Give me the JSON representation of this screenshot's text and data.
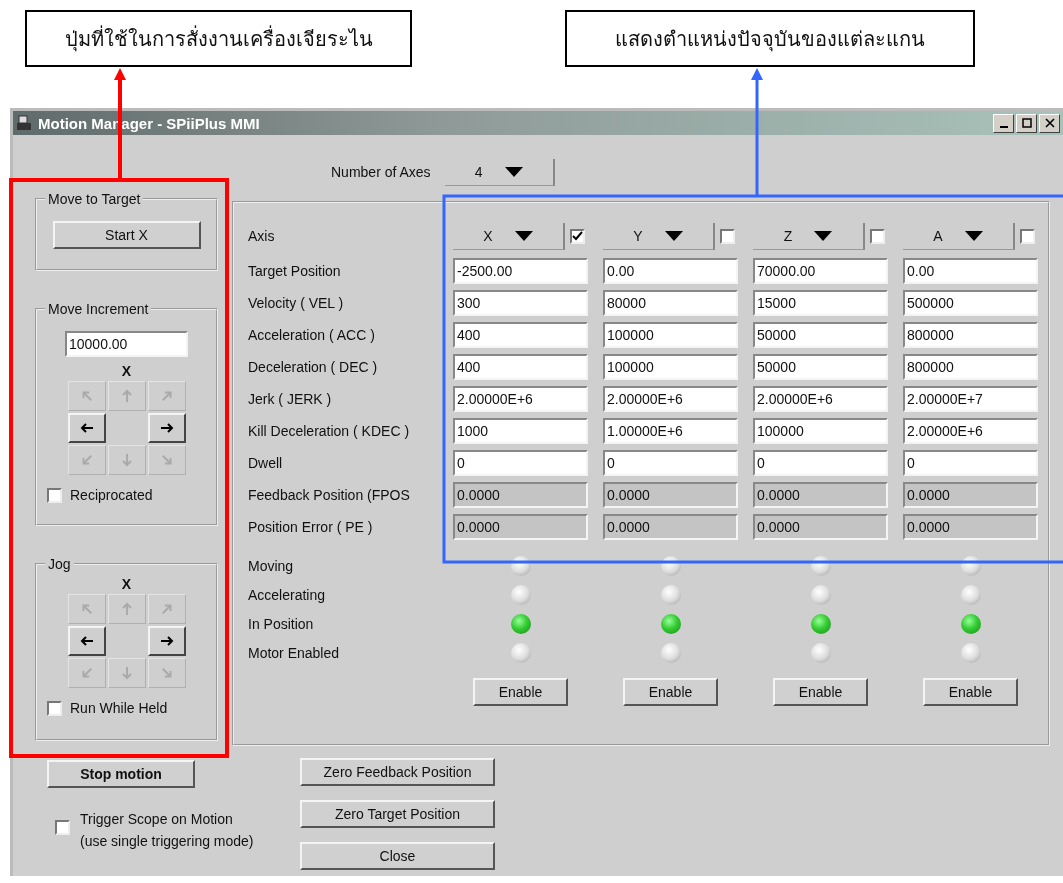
{
  "annotations": [
    {
      "text": "ปุ่มที่ใช้ในการสั่งงานเครื่องเจียระไน",
      "color": "#ff0000"
    },
    {
      "text": "แสดงตำแหน่งปัจจุบันของแต่ละแกน",
      "color": "#3366ff"
    }
  ],
  "window": {
    "title": "Motion Manager - SPiiPlus MMI"
  },
  "number_of_axes": {
    "label": "Number of Axes",
    "value": "4"
  },
  "move_to_target": {
    "title": "Move to Target",
    "button": "Start X"
  },
  "move_increment": {
    "title": "Move Increment",
    "value": "10000.00",
    "axis": "X",
    "pad": [
      {
        "kind": "nw",
        "disabled": true
      },
      {
        "kind": "n",
        "disabled": true
      },
      {
        "kind": "ne",
        "disabled": true
      },
      {
        "kind": "w",
        "disabled": false
      },
      {
        "kind": "e",
        "disabled": false
      },
      {
        "kind": "sw",
        "disabled": true
      },
      {
        "kind": "s",
        "disabled": true
      },
      {
        "kind": "se",
        "disabled": true
      }
    ],
    "reciprocated": {
      "label": "Reciprocated",
      "checked": false
    }
  },
  "jog": {
    "title": "Jog",
    "axis": "X",
    "pad": [
      {
        "kind": "nw",
        "disabled": true
      },
      {
        "kind": "n",
        "disabled": true
      },
      {
        "kind": "ne",
        "disabled": true
      },
      {
        "kind": "w",
        "disabled": false
      },
      {
        "kind": "e",
        "disabled": false
      },
      {
        "kind": "sw",
        "disabled": true
      },
      {
        "kind": "s",
        "disabled": true
      },
      {
        "kind": "se",
        "disabled": true
      }
    ],
    "run_while_held": {
      "label": "Run While Held",
      "checked": false
    }
  },
  "axes_panel": {
    "axis_label": "Axis",
    "rows": [
      {
        "label": "Target Position",
        "kind": "input"
      },
      {
        "label": "Velocity ( VEL )",
        "kind": "input"
      },
      {
        "label": "Acceleration ( ACC )",
        "kind": "input"
      },
      {
        "label": "Deceleration ( DEC )",
        "kind": "input"
      },
      {
        "label": "Jerk ( JERK )",
        "kind": "input"
      },
      {
        "label": "Kill Deceleration ( KDEC )",
        "kind": "input"
      },
      {
        "label": "Dwell",
        "kind": "input"
      },
      {
        "label": "Feedback Position (FPOS",
        "kind": "readout"
      },
      {
        "label": "Position Error ( PE )",
        "kind": "readout"
      }
    ],
    "indicators": [
      "Moving",
      "Accelerating",
      "In Position",
      "Motor Enabled"
    ],
    "axes": [
      {
        "name": "X",
        "checked": true,
        "values": [
          "-2500.00",
          "300",
          "400",
          "400",
          "2.00000E+6",
          "1000",
          "0",
          "0.0000",
          "0.0000"
        ],
        "leds": [
          {
            "on": false
          },
          {
            "on": false
          },
          {
            "on": true
          },
          {
            "on": false
          }
        ],
        "button": "Enable"
      },
      {
        "name": "Y",
        "checked": false,
        "values": [
          "0.00",
          "80000",
          "100000",
          "100000",
          "2.00000E+6",
          "1.00000E+6",
          "0",
          "0.0000",
          "0.0000"
        ],
        "leds": [
          {
            "on": false
          },
          {
            "on": false
          },
          {
            "on": true
          },
          {
            "on": false
          }
        ],
        "button": "Enable"
      },
      {
        "name": "Z",
        "checked": false,
        "values": [
          "70000.00",
          "15000",
          "50000",
          "50000",
          "2.00000E+6",
          "100000",
          "0",
          "0.0000",
          "0.0000"
        ],
        "leds": [
          {
            "on": false
          },
          {
            "on": false
          },
          {
            "on": true
          },
          {
            "on": false
          }
        ],
        "button": "Enable"
      },
      {
        "name": "A",
        "checked": false,
        "values": [
          "0.00",
          "500000",
          "800000",
          "800000",
          "2.00000E+7",
          "2.00000E+6",
          "0",
          "0.0000",
          "0.0000"
        ],
        "leds": [
          {
            "on": false
          },
          {
            "on": false
          },
          {
            "on": true
          },
          {
            "on": false
          }
        ],
        "button": "Enable"
      }
    ]
  },
  "bottom": {
    "stop_button": "Stop motion",
    "trigger_scope": {
      "label_lines": [
        "Trigger Scope on Motion",
        "(use single triggering mode)"
      ],
      "checked": false
    },
    "buttons": [
      "Zero Feedback Position",
      "Zero Target Position",
      "Close"
    ]
  }
}
